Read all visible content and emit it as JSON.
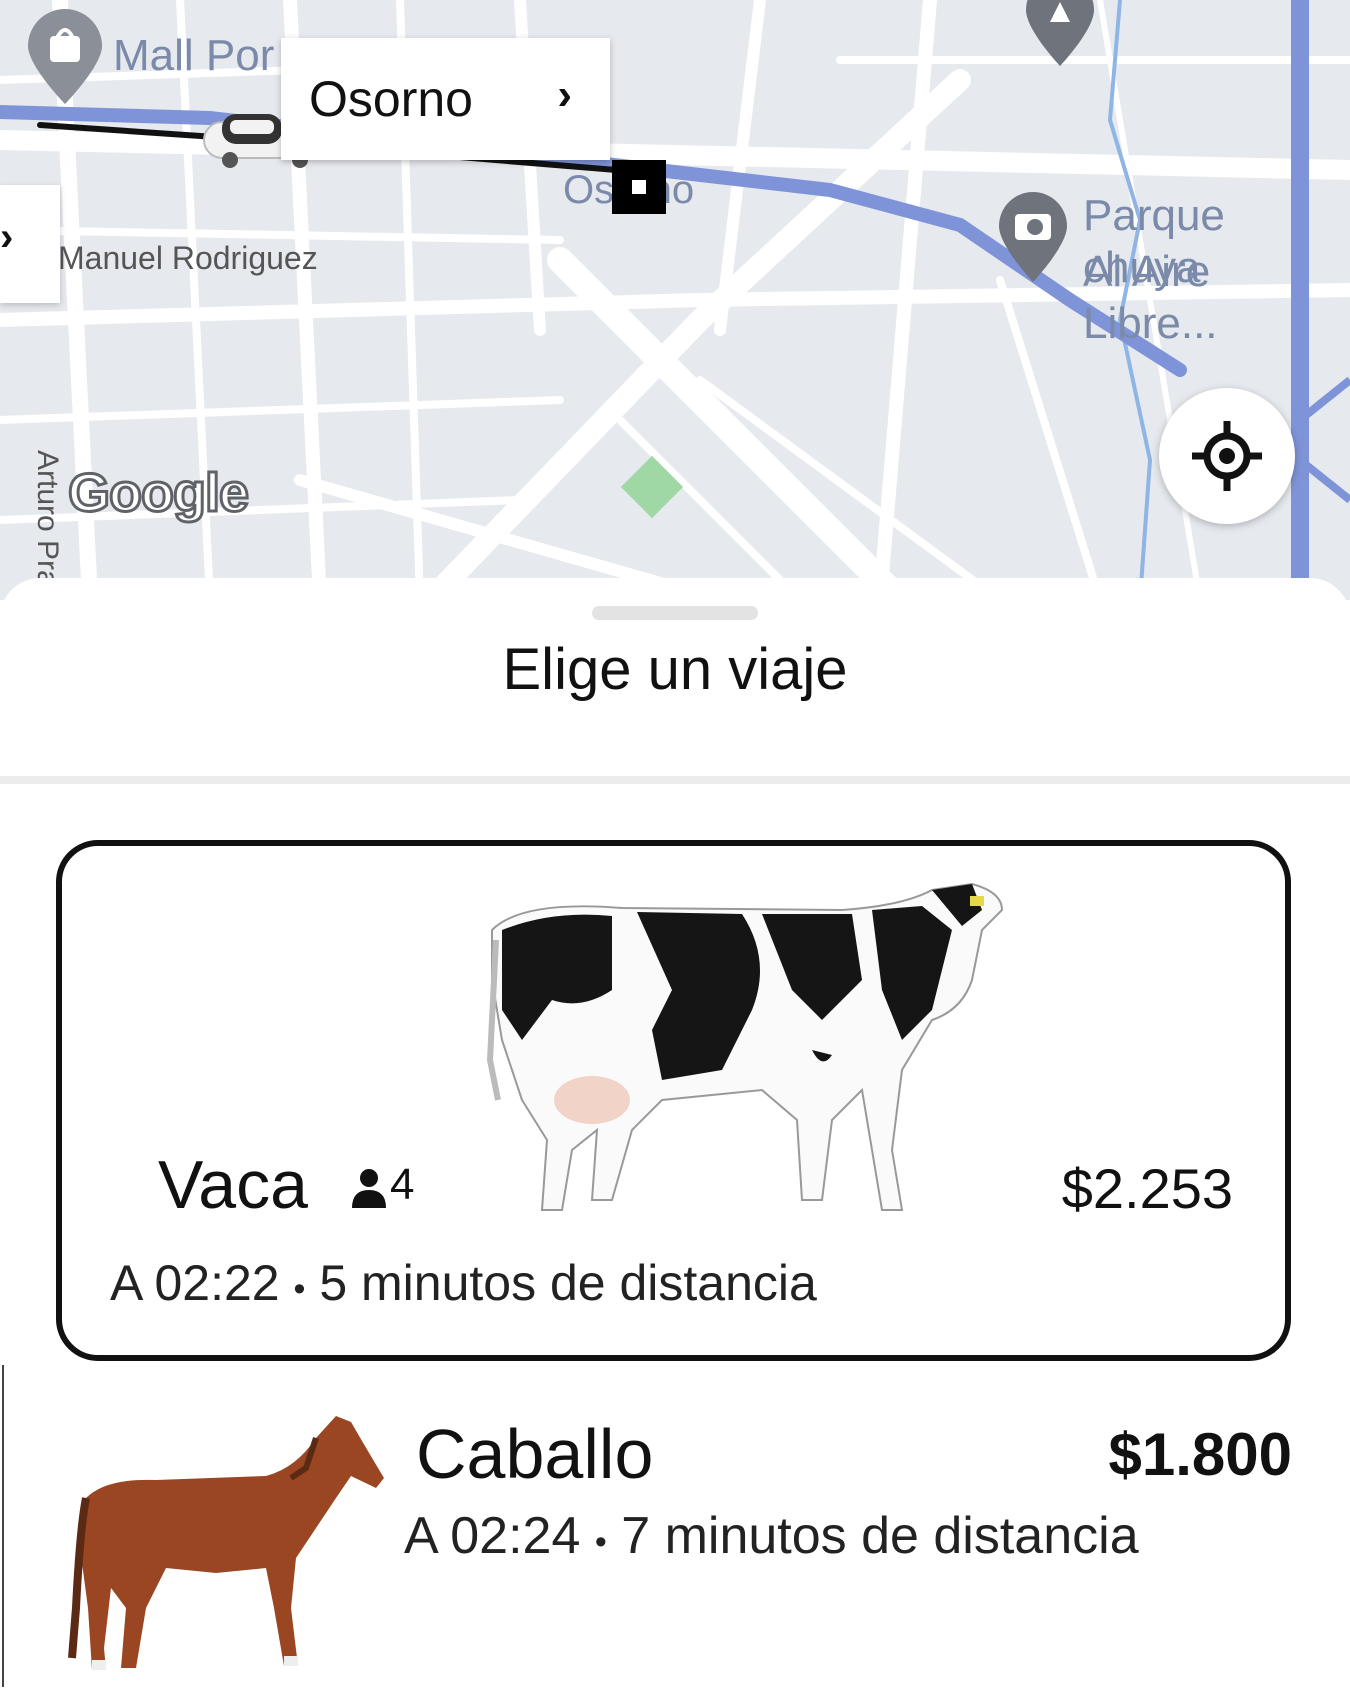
{
  "map": {
    "destination_card": {
      "label": "Osorno",
      "chevron": "›"
    },
    "labels": {
      "mall": "Mall Por",
      "street_manuel": "Manuel Rodriguez",
      "street_arturo": "Arturo Prat",
      "city_osorno": "Osorno",
      "park_line1": "Parque chuya",
      "park_line2": "Al Aire Libre..."
    },
    "google_logo": "Google",
    "side_chevron": "›",
    "icons": [
      "shopping-bag-pin-icon",
      "camera-pin-icon",
      "tree-pin-icon",
      "car-icon",
      "destination-marker-icon",
      "locate-icon"
    ],
    "colors": {
      "route": "#7f94d8",
      "route_active": "#111111",
      "park": "#9fd8a4"
    }
  },
  "sheet": {
    "title": "Elige un viaje",
    "rides": [
      {
        "name": "Vaca",
        "capacity": "4",
        "price": "$2.253",
        "eta": "A 02:22",
        "separator": "•",
        "distance": "5 minutos de distancia",
        "selected": true,
        "icon": "cow-icon"
      },
      {
        "name": "Caballo",
        "price": "$1.800",
        "eta": "A 02:24",
        "separator": "•",
        "distance": "7 minutos de distancia",
        "selected": false,
        "icon": "horse-icon"
      }
    ]
  }
}
